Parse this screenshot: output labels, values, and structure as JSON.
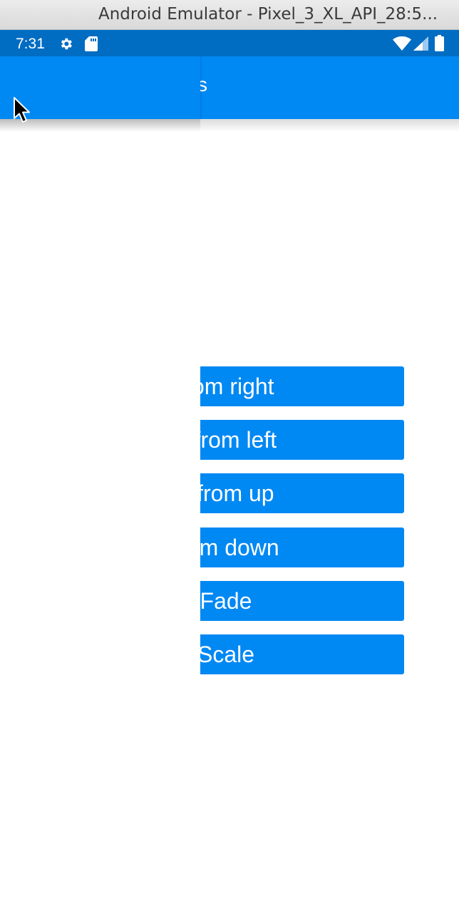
{
  "window": {
    "title": "Android Emulator - Pixel_3_XL_API_28:5..."
  },
  "status_bar": {
    "time": "7:31",
    "left_icons": [
      "settings-icon",
      "sd-card-icon"
    ],
    "right_icons": [
      "wifi-icon",
      "cell-signal-icon",
      "battery-icon"
    ],
    "color": "#006cc2"
  },
  "app_bar": {
    "visible_title": "s",
    "color": "#0088f3"
  },
  "buttons": [
    {
      "label": "Slide from right",
      "visible_text": " from right"
    },
    {
      "label": "Slide from left",
      "visible_text": "e from left"
    },
    {
      "label": "Slide from up",
      "visible_text": "e from up"
    },
    {
      "label": "Slide from down",
      "visible_text": " from down"
    },
    {
      "label": "Fade",
      "visible_text": "Fade"
    },
    {
      "label": "Scale",
      "visible_text": "Scale"
    }
  ],
  "colors": {
    "accent": "#0088f3",
    "status_bar": "#006cc2",
    "background": "#ffffff",
    "text_on_accent": "#ffffff"
  }
}
